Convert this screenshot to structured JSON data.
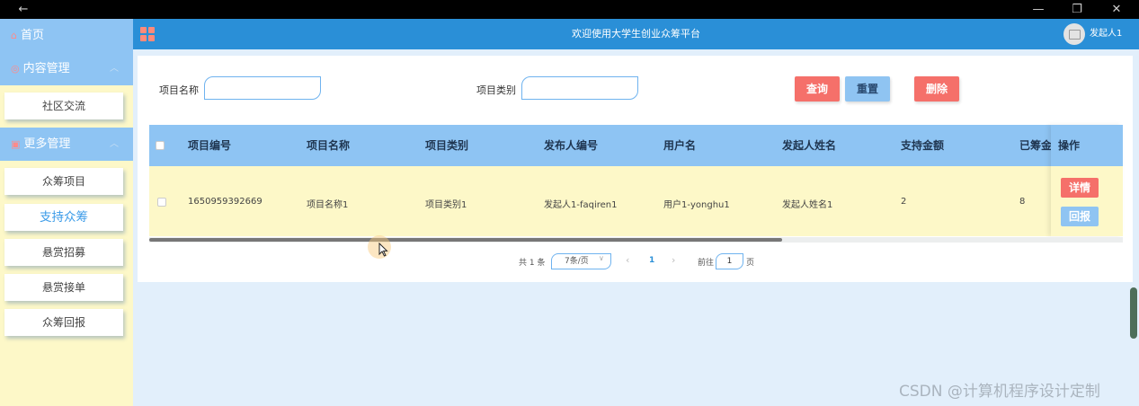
{
  "window": {
    "back_glyph": "←",
    "minimize_glyph": "—",
    "restore_glyph": "❐",
    "close_glyph": "✕"
  },
  "sidebar": {
    "home": {
      "label": "首页",
      "icon": "home-icon"
    },
    "groups": [
      {
        "label": "内容管理",
        "icon": "content-icon",
        "items": [
          "社区交流"
        ]
      },
      {
        "label": "更多管理",
        "icon": "more-icon",
        "items": [
          "众筹项目",
          "支持众筹",
          "悬赏招募",
          "悬赏接单",
          "众筹回报"
        ]
      }
    ],
    "active_item": "支持众筹"
  },
  "header": {
    "title": "欢迎使用大学生创业众筹平台",
    "username": "发起人1"
  },
  "search": {
    "name_label": "项目名称",
    "type_label": "项目类别",
    "name_value": "",
    "type_value": "",
    "query_label": "查询",
    "reset_label": "重置",
    "delete_label": "删除"
  },
  "table": {
    "columns": [
      "项目编号",
      "项目名称",
      "项目类别",
      "发布人编号",
      "用户名",
      "发起人姓名",
      "支持金额",
      "已筹金"
    ],
    "op_label": "操作",
    "rows": [
      {
        "cells": [
          "1650959392669",
          "项目名称1",
          "项目类别1",
          "发起人1-faqiren1",
          "用户1-yonghu1",
          "发起人姓名1",
          "2",
          "8"
        ],
        "detail_label": "详情",
        "report_label": "回报"
      }
    ],
    "horizontal_scroll_fraction": 0.65
  },
  "pagination": {
    "total_text": "共 1 条",
    "page_size": "7条/页",
    "prev_glyph": "‹",
    "current_page": "1",
    "next_glyph": "›",
    "goto_label": "前往",
    "goto_value": "1",
    "page_unit": "页"
  },
  "watermark": "CSDN @计算机程序设计定制",
  "colors": {
    "sidebar_bg": "#fdf8c8",
    "menu_head": "#8ec4f3",
    "header": "#2a8fd7",
    "danger": "#f5706a",
    "primary_light": "#8fc4f2",
    "content_bg": "#e2effb"
  }
}
